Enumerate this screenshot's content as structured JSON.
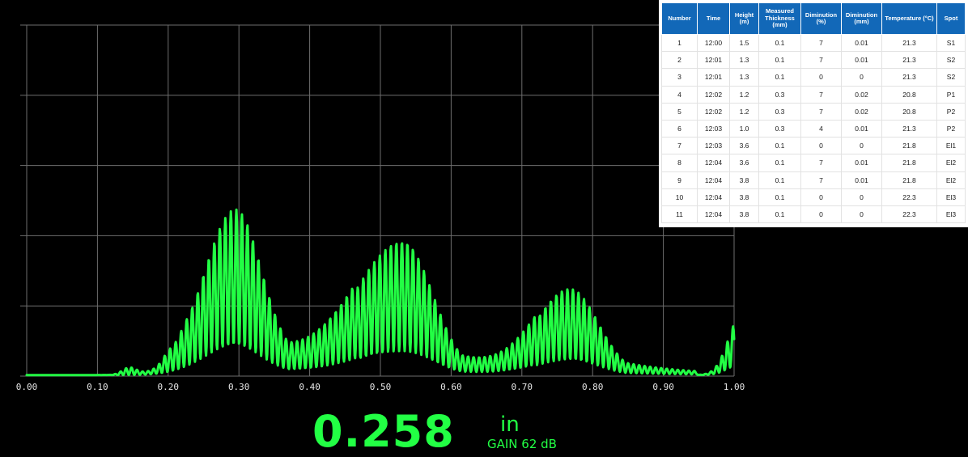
{
  "chart_data": {
    "type": "line",
    "x_ticks": [
      "0.00",
      "0.10",
      "0.20",
      "0.30",
      "0.40",
      "0.50",
      "0.60",
      "0.70",
      "0.80",
      "0.90",
      "1.00"
    ],
    "xlim": [
      0,
      1
    ],
    "ylim": [
      0,
      1
    ],
    "grid": true,
    "line_color": "#22ff44",
    "grid_color": "#6e6e6e",
    "baseline": 0.003,
    "echoes": [
      {
        "position": 0.295,
        "amplitude": 0.47,
        "rise": 0.045,
        "decay": 0.038
      },
      {
        "position": 0.532,
        "amplitude": 0.38,
        "rise": 0.07,
        "decay": 0.042
      },
      {
        "position": 0.768,
        "amplitude": 0.245,
        "rise": 0.05,
        "decay": 0.04
      },
      {
        "position": 1.01,
        "amplitude": 0.17,
        "rise": 0.018,
        "decay": 0.02
      }
    ],
    "small_blips": [
      {
        "position": 0.145,
        "amplitude": 0.02,
        "width": 0.01
      },
      {
        "position": 0.2,
        "amplitude": 0.018,
        "width": 0.008
      },
      {
        "position": 0.222,
        "amplitude": 0.015,
        "width": 0.008
      }
    ],
    "oscillation_period": 0.0078
  },
  "readout": {
    "value": "0.258",
    "unit": "in",
    "gain": "GAIN 62 dB"
  },
  "table": {
    "header_color": "#1268b8",
    "columns": [
      "Number",
      "Time",
      "Height (m)",
      "Measured Thickness (mm)",
      "Diminution (%)",
      "Diminution (mm)",
      "Temperature (°C)",
      "Spot"
    ],
    "rows": [
      [
        "1",
        "12:00",
        "1.5",
        "0.1",
        "7",
        "0.01",
        "21.3",
        "S1"
      ],
      [
        "2",
        "12:01",
        "1.3",
        "0.1",
        "7",
        "0.01",
        "21.3",
        "S2"
      ],
      [
        "3",
        "12:01",
        "1.3",
        "0.1",
        "0",
        "0",
        "21.3",
        "S2"
      ],
      [
        "4",
        "12:02",
        "1.2",
        "0.3",
        "7",
        "0.02",
        "20.8",
        "P1"
      ],
      [
        "5",
        "12:02",
        "1.2",
        "0.3",
        "7",
        "0.02",
        "20.8",
        "P2"
      ],
      [
        "6",
        "12:03",
        "1.0",
        "0.3",
        "4",
        "0.01",
        "21.3",
        "P2"
      ],
      [
        "7",
        "12:03",
        "3.6",
        "0.1",
        "0",
        "0",
        "21.8",
        "El1"
      ],
      [
        "8",
        "12:04",
        "3.6",
        "0.1",
        "7",
        "0.01",
        "21.8",
        "El2"
      ],
      [
        "9",
        "12:04",
        "3.8",
        "0.1",
        "7",
        "0.01",
        "21.8",
        "El2"
      ],
      [
        "10",
        "12:04",
        "3.8",
        "0.1",
        "0",
        "0",
        "22.3",
        "El3"
      ],
      [
        "11",
        "12:04",
        "3.8",
        "0.1",
        "0",
        "0",
        "22.3",
        "El3"
      ]
    ]
  }
}
